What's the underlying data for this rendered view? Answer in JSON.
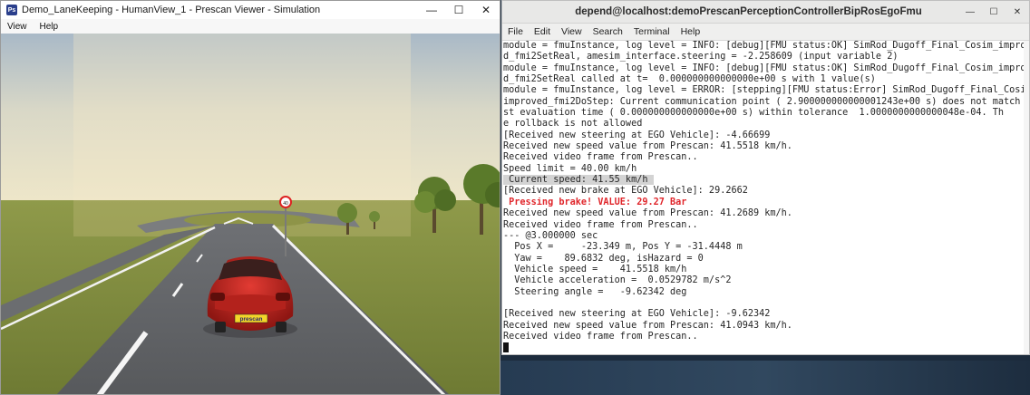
{
  "left_window": {
    "title": "Demo_LaneKeeping - HumanView_1 - Prescan Viewer - Simulation",
    "menu": [
      "View",
      "Help"
    ],
    "controls": {
      "minimize": "—",
      "maximize": "☐",
      "close": "✕"
    },
    "scene": {
      "plate_text": "prescan",
      "sign_text": "40"
    }
  },
  "right_window": {
    "title": "depend@localhost:demoPrescanPerceptionControllerBipRosEgoFmu",
    "controls": {
      "minimize": "—",
      "maximize": "☐",
      "close": "✕"
    },
    "menu": [
      "File",
      "Edit",
      "View",
      "Search",
      "Terminal",
      "Help"
    ],
    "lines": [
      {
        "text": "module = fmuInstance, log level = INFO: [debug][FMU status:OK] SimRod_Dugoff_Final_Cosim_improve",
        "style": "normal"
      },
      {
        "text": "d_fmi2SetReal, amesim_interface.steering = -2.258609 (input variable 2)",
        "style": "normal"
      },
      {
        "text": "module = fmuInstance, log level = INFO: [debug][FMU status:OK] SimRod_Dugoff_Final_Cosim_improve",
        "style": "normal"
      },
      {
        "text": "d_fmi2SetReal called at t=  0.000000000000000e+00 s with 1 value(s)",
        "style": "normal"
      },
      {
        "text": "module = fmuInstance, log level = ERROR: [stepping][FMU status:Error] SimRod_Dugoff_Final_Cosim_",
        "style": "normal"
      },
      {
        "text": "improved_fmi2DoStep: Current communication point ( 2.900000000000001243e+00 s) does not match la",
        "style": "normal"
      },
      {
        "text": "st evaluation time ( 0.000000000000000e+00 s) within tolerance  1.0000000000000048e-04. Th",
        "style": "normal"
      },
      {
        "text": "e rollback is not allowed",
        "style": "normal"
      },
      {
        "text": "[Received new steering at EGO Vehicle]: -4.66699",
        "style": "normal"
      },
      {
        "text": "Received new speed value from Prescan: 41.5518 km/h.",
        "style": "normal"
      },
      {
        "text": "Received video frame from Prescan..",
        "style": "normal"
      },
      {
        "text": "Speed limit = 40.00 km/h",
        "style": "normal"
      },
      {
        "text": " Current speed: 41.55 km/h ",
        "style": "highlight"
      },
      {
        "text": "[Received new brake at EGO Vehicle]: 29.2662",
        "style": "normal"
      },
      {
        "text": " Pressing brake! VALUE: 29.27 Bar",
        "style": "error"
      },
      {
        "text": "Received new speed value from Prescan: 41.2689 km/h.",
        "style": "normal"
      },
      {
        "text": "Received video frame from Prescan..",
        "style": "normal"
      },
      {
        "text": "--- @3.000000 sec",
        "style": "normal"
      },
      {
        "text": "  Pos X =     -23.349 m, Pos Y = -31.4448 m",
        "style": "normal"
      },
      {
        "text": "  Yaw =    89.6832 deg, isHazard = 0",
        "style": "normal"
      },
      {
        "text": "  Vehicle speed =    41.5518 km/h",
        "style": "normal"
      },
      {
        "text": "  Vehicle acceleration =  0.0529782 m/s^2",
        "style": "normal"
      },
      {
        "text": "  Steering angle =   -9.62342 deg",
        "style": "normal"
      },
      {
        "text": "",
        "style": "normal"
      },
      {
        "text": "[Received new steering at EGO Vehicle]: -9.62342",
        "style": "normal"
      },
      {
        "text": "Received new speed value from Prescan: 41.0943 km/h.",
        "style": "normal"
      },
      {
        "text": "Received video frame from Prescan..",
        "style": "normal"
      }
    ]
  }
}
